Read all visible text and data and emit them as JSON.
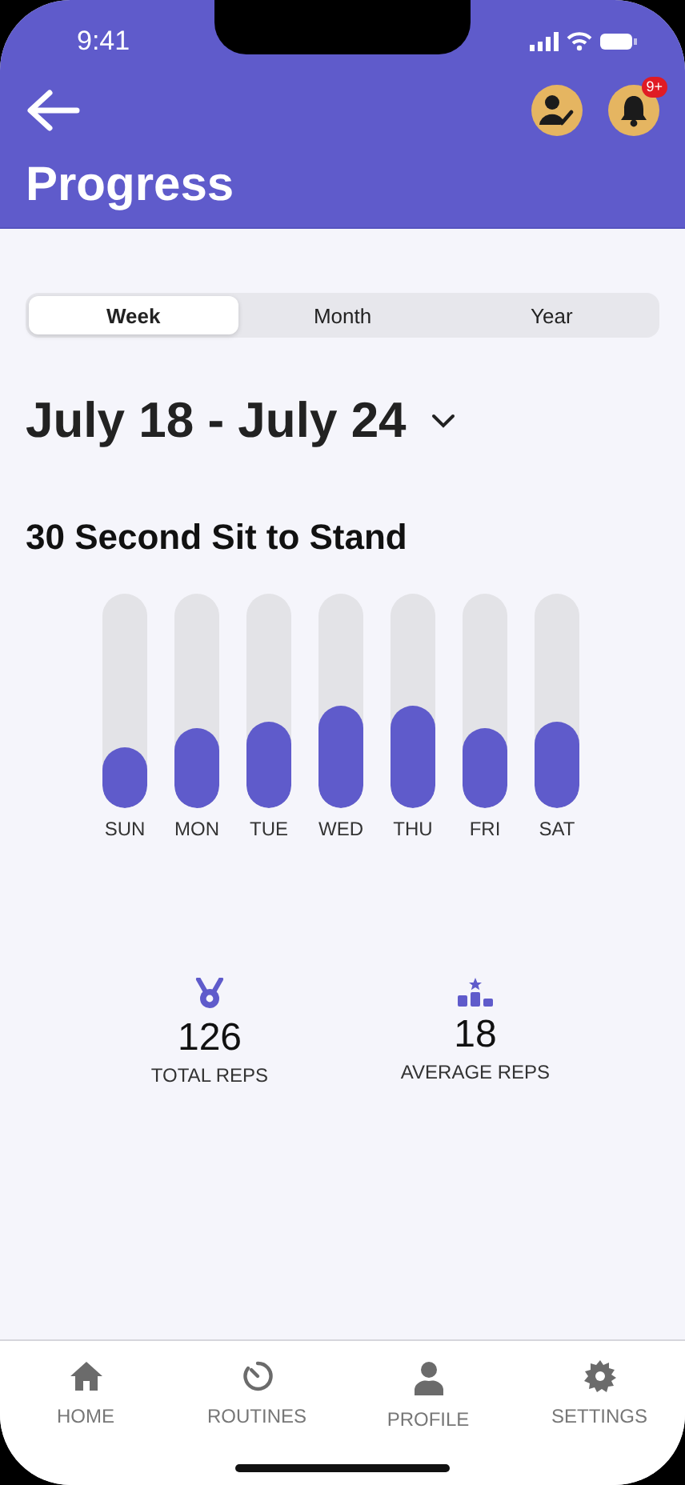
{
  "status_bar": {
    "time": "9:41"
  },
  "header": {
    "title": "Progress",
    "notification_badge": "9+"
  },
  "period_tabs": [
    {
      "label": "Week",
      "selected": true
    },
    {
      "label": "Month",
      "selected": false
    },
    {
      "label": "Year",
      "selected": false
    }
  ],
  "date_range": "July 18 - July 24",
  "exercise": {
    "title": "30 Second Sit to Stand",
    "days": [
      {
        "label": "SUN",
        "level": 0.28
      },
      {
        "label": "MON",
        "level": 0.37
      },
      {
        "label": "TUE",
        "level": 0.4
      },
      {
        "label": "WED",
        "level": 0.48
      },
      {
        "label": "THU",
        "level": 0.48
      },
      {
        "label": "FRI",
        "level": 0.37
      },
      {
        "label": "SAT",
        "level": 0.4
      }
    ]
  },
  "stats": [
    {
      "kind": "medal",
      "value": "126",
      "label": "TOTAL REPS"
    },
    {
      "kind": "podium",
      "value": "18",
      "label": "AVERAGE REPS"
    }
  ],
  "tab_bar": [
    {
      "kind": "home",
      "label": "HOME"
    },
    {
      "kind": "timer",
      "label": "ROUTINES"
    },
    {
      "kind": "person",
      "label": "PROFILE"
    },
    {
      "kind": "gear",
      "label": "SETTINGS"
    }
  ]
}
